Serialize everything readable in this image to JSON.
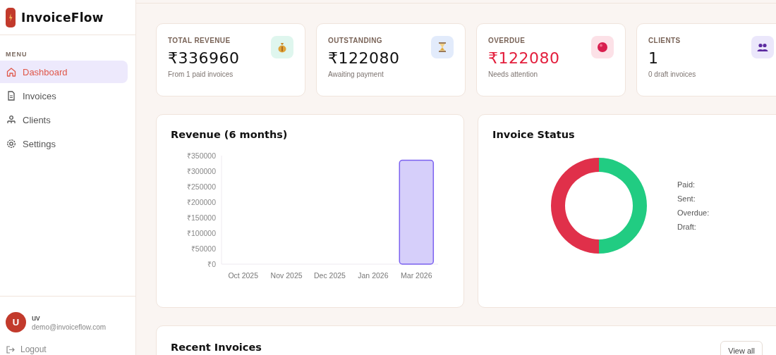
{
  "brand": {
    "name": "InvoiceFlow"
  },
  "sidebar": {
    "section_label": "MENU",
    "items": [
      {
        "label": "Dashboard",
        "kind": "home",
        "selected": true
      },
      {
        "label": "Invoices",
        "kind": "document",
        "selected": false
      },
      {
        "label": "Clients",
        "kind": "people",
        "selected": false
      },
      {
        "label": "Settings",
        "kind": "gear",
        "selected": false
      }
    ],
    "user": {
      "initial": "U",
      "name": "uv",
      "email": "demo@invoiceflow.com"
    },
    "logout": "Logout"
  },
  "stats": [
    {
      "label": "TOTAL REVENUE",
      "value": "₹336960",
      "note": "From 1 paid invoices",
      "kind": "money-bag",
      "color": "#dff6ee",
      "alert": false
    },
    {
      "label": "OUTSTANDING",
      "value": "₹122080",
      "note": "Awaiting payment",
      "kind": "hourglass",
      "color": "#e2ebfb",
      "alert": false
    },
    {
      "label": "OVERDUE",
      "value": "₹122080",
      "note": "Needs attention",
      "kind": "dot",
      "color": "#fce1e7",
      "alert": true
    },
    {
      "label": "CLIENTS",
      "value": "1",
      "note": "0 draft invoices",
      "kind": "people",
      "color": "#ebe7fb",
      "alert": false
    }
  ],
  "revenue": {
    "title": "Revenue (6 months)",
    "chart_data": {
      "type": "bar",
      "categories": [
        "Oct 2025",
        "Nov 2025",
        "Dec 2025",
        "Jan 2026",
        "Mar 2026"
      ],
      "series": [
        {
          "color": "#d6cffa",
          "values": [
            0,
            0,
            0,
            0,
            335000
          ]
        }
      ],
      "ylim": [
        0,
        350000
      ],
      "yticks": [
        {
          "value": 0,
          "label": "₹0"
        },
        {
          "value": 50000,
          "label": "₹50000"
        },
        {
          "value": 100000,
          "label": "₹100000"
        },
        {
          "value": 150000,
          "label": "₹150000"
        },
        {
          "value": 200000,
          "label": "₹200000"
        },
        {
          "value": 250000,
          "label": "₹250000"
        },
        {
          "value": 300000,
          "label": "₹300000"
        },
        {
          "value": 350000,
          "label": "₹350000"
        }
      ]
    }
  },
  "status": {
    "title": "Invoice Status",
    "legend_separator": ":",
    "chart_data": {
      "type": "donut",
      "categories": [
        "Paid",
        "Sent",
        "Overdue",
        "Draft"
      ],
      "values": [
        50,
        0,
        50,
        0
      ],
      "colors": [
        "#21cc82",
        null,
        "#e0304a",
        null
      ]
    }
  },
  "recent": {
    "title": "Recent Invoices",
    "action": "View all"
  }
}
